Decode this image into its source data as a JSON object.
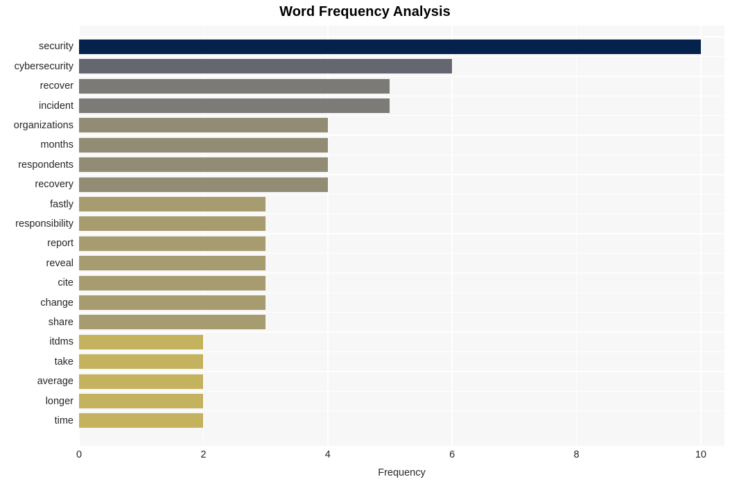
{
  "chart_data": {
    "type": "bar",
    "orientation": "horizontal",
    "title": "Word Frequency Analysis",
    "xlabel": "Frequency",
    "ylabel": "",
    "xlim": [
      0,
      10.38
    ],
    "xticks": [
      0,
      2,
      4,
      6,
      8,
      10
    ],
    "xtick_labels": [
      "0",
      "2",
      "4",
      "6",
      "8",
      "10"
    ],
    "grid": true,
    "legend": null,
    "categories": [
      "security",
      "cybersecurity",
      "recover",
      "incident",
      "organizations",
      "months",
      "respondents",
      "recovery",
      "fastly",
      "responsibility",
      "report",
      "reveal",
      "cite",
      "change",
      "share",
      "itdms",
      "take",
      "average",
      "longer",
      "time"
    ],
    "values": [
      10,
      6,
      5,
      5,
      4,
      4,
      4,
      4,
      3,
      3,
      3,
      3,
      3,
      3,
      3,
      2,
      2,
      2,
      2,
      2
    ],
    "bar_colors": [
      "#04224c",
      "#64676f",
      "#7b7a77",
      "#7d7b78",
      "#918c73",
      "#918c73",
      "#918c73",
      "#918c73",
      "#a79c6f",
      "#a79c6f",
      "#a79c6f",
      "#a79c6f",
      "#a79c6f",
      "#a79c6f",
      "#a79c6f",
      "#c5b25f",
      "#c5b25f",
      "#c5b25f",
      "#c5b25f",
      "#c5b25f"
    ],
    "plot_background": "#f7f7f7",
    "grid_color": "#ffffff",
    "figure_background": "#ffffff",
    "title_color": "#000000",
    "tick_color": "#262626"
  }
}
